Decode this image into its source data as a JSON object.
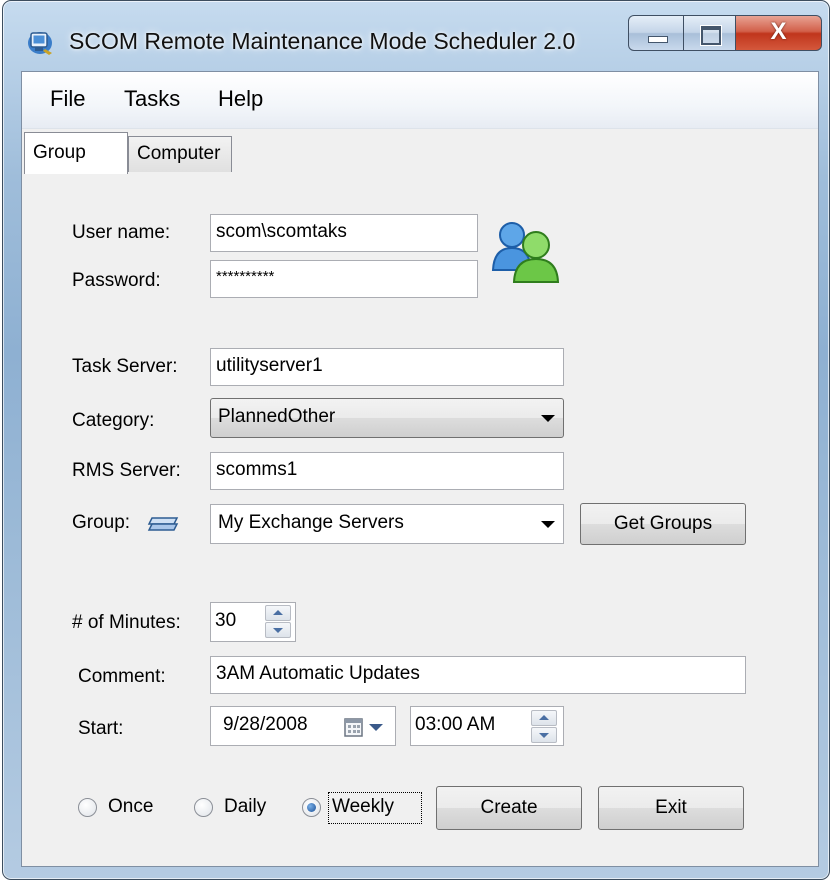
{
  "window": {
    "title": "SCOM Remote Maintenance Mode Scheduler  2.0",
    "close_glyph": "X"
  },
  "menu": [
    "File",
    "Tasks",
    "Help"
  ],
  "tabs": [
    {
      "label": "Group",
      "active": true
    },
    {
      "label": "Computer",
      "active": false
    }
  ],
  "form": {
    "username_label": "User name:",
    "username_value": "scom\\scomtaks",
    "password_label": "Password:",
    "password_value": "**********",
    "task_server_label": "Task Server:",
    "task_server_value": "utilityserver1",
    "category_label": "Category:",
    "category_value": "PlannedOther",
    "rms_server_label": "RMS Server:",
    "rms_server_value": "scomms1",
    "group_label": "Group:",
    "group_value": "My Exchange Servers",
    "get_groups_label": "Get Groups",
    "minutes_label": "# of Minutes:",
    "minutes_value": "30",
    "comment_label": "Comment:",
    "comment_value": "3AM Automatic Updates",
    "start_label": "Start:",
    "start_date": "9/28/2008",
    "start_time": "03:00 AM"
  },
  "recurrence": {
    "options": [
      "Once",
      "Daily",
      "Weekly"
    ],
    "selected": "Weekly"
  },
  "buttons": {
    "create": "Create",
    "exit": "Exit"
  },
  "icons": {
    "app": "monitor-app-icon",
    "users": "users-icon",
    "group": "group-stack-icon",
    "calendar": "calendar-icon"
  }
}
